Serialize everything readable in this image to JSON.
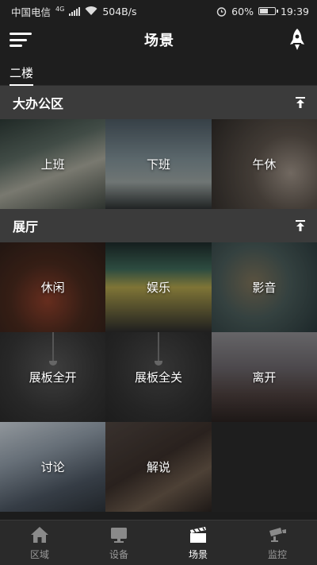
{
  "status_bar": {
    "carrier": "中国电信",
    "network": "4G",
    "speed": "504B/s",
    "battery": "60%",
    "battery_level": 0.6,
    "time": "19:39"
  },
  "header": {
    "title": "场景",
    "menu_icon": "menu-icon",
    "action_icon": "rocket-icon"
  },
  "floor_tabs": [
    {
      "label": "二楼",
      "active": true
    }
  ],
  "sections": [
    {
      "title": "大办公区",
      "collapse_icon": "collapse-up-icon",
      "scenes": [
        {
          "label": "上班"
        },
        {
          "label": "下班"
        },
        {
          "label": "午休"
        }
      ]
    },
    {
      "title": "展厅",
      "collapse_icon": "collapse-up-icon",
      "scenes": [
        {
          "label": "休闲"
        },
        {
          "label": "娱乐"
        },
        {
          "label": "影音"
        },
        {
          "label": "展板全开"
        },
        {
          "label": "展板全关"
        },
        {
          "label": "离开"
        },
        {
          "label": "讨论"
        },
        {
          "label": "解说"
        }
      ]
    }
  ],
  "bottom_nav": [
    {
      "label": "区域",
      "icon": "home-icon",
      "active": false
    },
    {
      "label": "设备",
      "icon": "monitor-icon",
      "active": false
    },
    {
      "label": "场景",
      "icon": "clapperboard-icon",
      "active": true
    },
    {
      "label": "监控",
      "icon": "camera-icon",
      "active": false
    }
  ],
  "colors": {
    "background": "#1c1c1c",
    "section_header": "#3b3b3b",
    "nav_bar": "#2a2a2a",
    "nav_inactive": "#9a9a9a",
    "nav_active": "#ffffff"
  }
}
